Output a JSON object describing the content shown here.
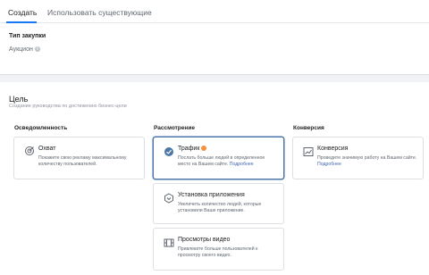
{
  "tabs": [
    {
      "label": "Создать",
      "active": true
    },
    {
      "label": "Использовать существующие",
      "active": false
    }
  ],
  "buy_type": {
    "label": "Тип закупки",
    "value": "Аукцион"
  },
  "goal": {
    "title": "Цель",
    "subtitle": "Создание руководства по достижению бизнес-цели"
  },
  "columns": [
    {
      "header": "Осведомленность"
    },
    {
      "header": "Рассмотрение"
    },
    {
      "header": "Конверсия"
    }
  ],
  "cards": {
    "reach": {
      "title": "Охват",
      "desc": "Покажите свою рекламу максимальному количеству пользователей.",
      "icon": "target-icon"
    },
    "traffic": {
      "title": "Трафик",
      "desc": "Послать больше людей в определенное место на Вашем сайте.",
      "link": "Подробнее",
      "icon": "check-circle-icon",
      "selected": true
    },
    "app_install": {
      "title": "Установка приложения",
      "desc": "Увеличить количество людей, которые установили Ваше приложение.",
      "icon": "app-box-icon"
    },
    "video_views": {
      "title": "Просмотры видео",
      "desc": "Привлеките больше пользователей к просмотру своего видео.",
      "icon": "film-icon"
    },
    "conversion": {
      "title": "Конверсия",
      "desc": "Проведите значимую работу на Вашем сайте.",
      "link": "Подробнее",
      "icon": "chart-icon"
    }
  },
  "colors": {
    "accent": "#4a76a8",
    "tab_underline": "#1877f2",
    "badge": "#f7923b",
    "link": "#4267b2"
  }
}
